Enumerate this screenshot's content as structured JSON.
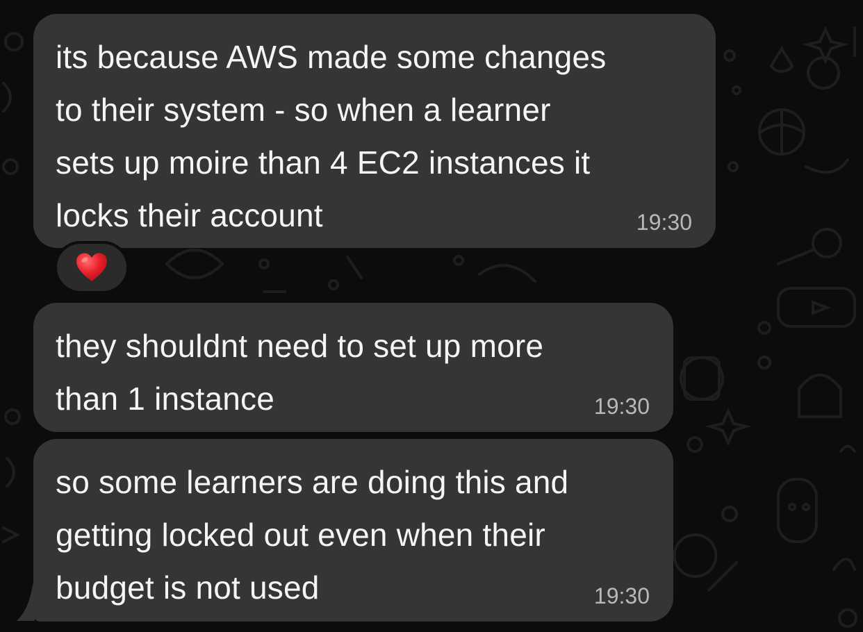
{
  "messages": [
    {
      "text": "its because AWS made some changes\nto their system - so when a learner\nsets up moire than 4 EC2 instances it\nlocks their account",
      "time": "19:30"
    },
    {
      "text": "they shouldnt need to set up more\nthan 1 instance",
      "time": "19:30"
    },
    {
      "text": "so some learners are doing this and\ngetting locked out even when their\nbudget is not used",
      "time": "19:30"
    }
  ],
  "reaction": {
    "icon": "red-heart-icon",
    "color": "#e8202a"
  },
  "colors": {
    "bubble": "#353535",
    "background": "#0c0c0c",
    "text": "#f5f5f5",
    "timestamp": "#b9b9b9"
  }
}
